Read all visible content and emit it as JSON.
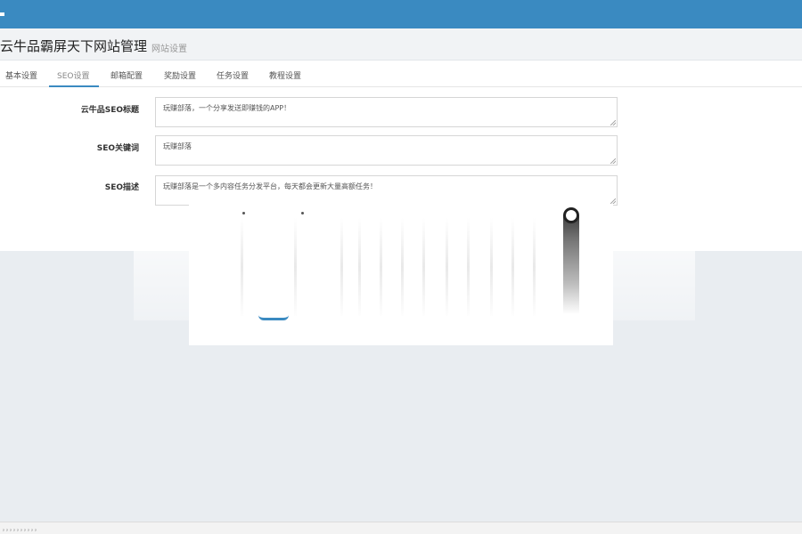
{
  "header": {
    "title": "云牛品霸屏天下网站管理",
    "subtitle": "网站设置"
  },
  "tabs": [
    {
      "label": "基本设置",
      "active": false
    },
    {
      "label": "SEO设置",
      "active": true
    },
    {
      "label": "邮箱配置",
      "active": false
    },
    {
      "label": "奖励设置",
      "active": false
    },
    {
      "label": "任务设置",
      "active": false
    },
    {
      "label": "教程设置",
      "active": false
    }
  ],
  "form": {
    "seo_title": {
      "label": "云牛品SEO标题",
      "value": "玩赚部落，一个分享发送即赚钱的APP！"
    },
    "seo_keywords": {
      "label": "SEO关键词",
      "value": "玩赚部落"
    },
    "seo_description": {
      "label": "SEO描述",
      "value": "玩赚部落是一个多内容任务分发平台，每天都会更新大量高额任务！"
    }
  },
  "status_bar": {
    "text": "，，，，，，，，，，"
  },
  "colors": {
    "topbar": "#3a8ac1",
    "accent": "#3a8ac1",
    "page_background": "#e9edf1"
  },
  "icons": {
    "loading": "loading-spinner-icon"
  }
}
